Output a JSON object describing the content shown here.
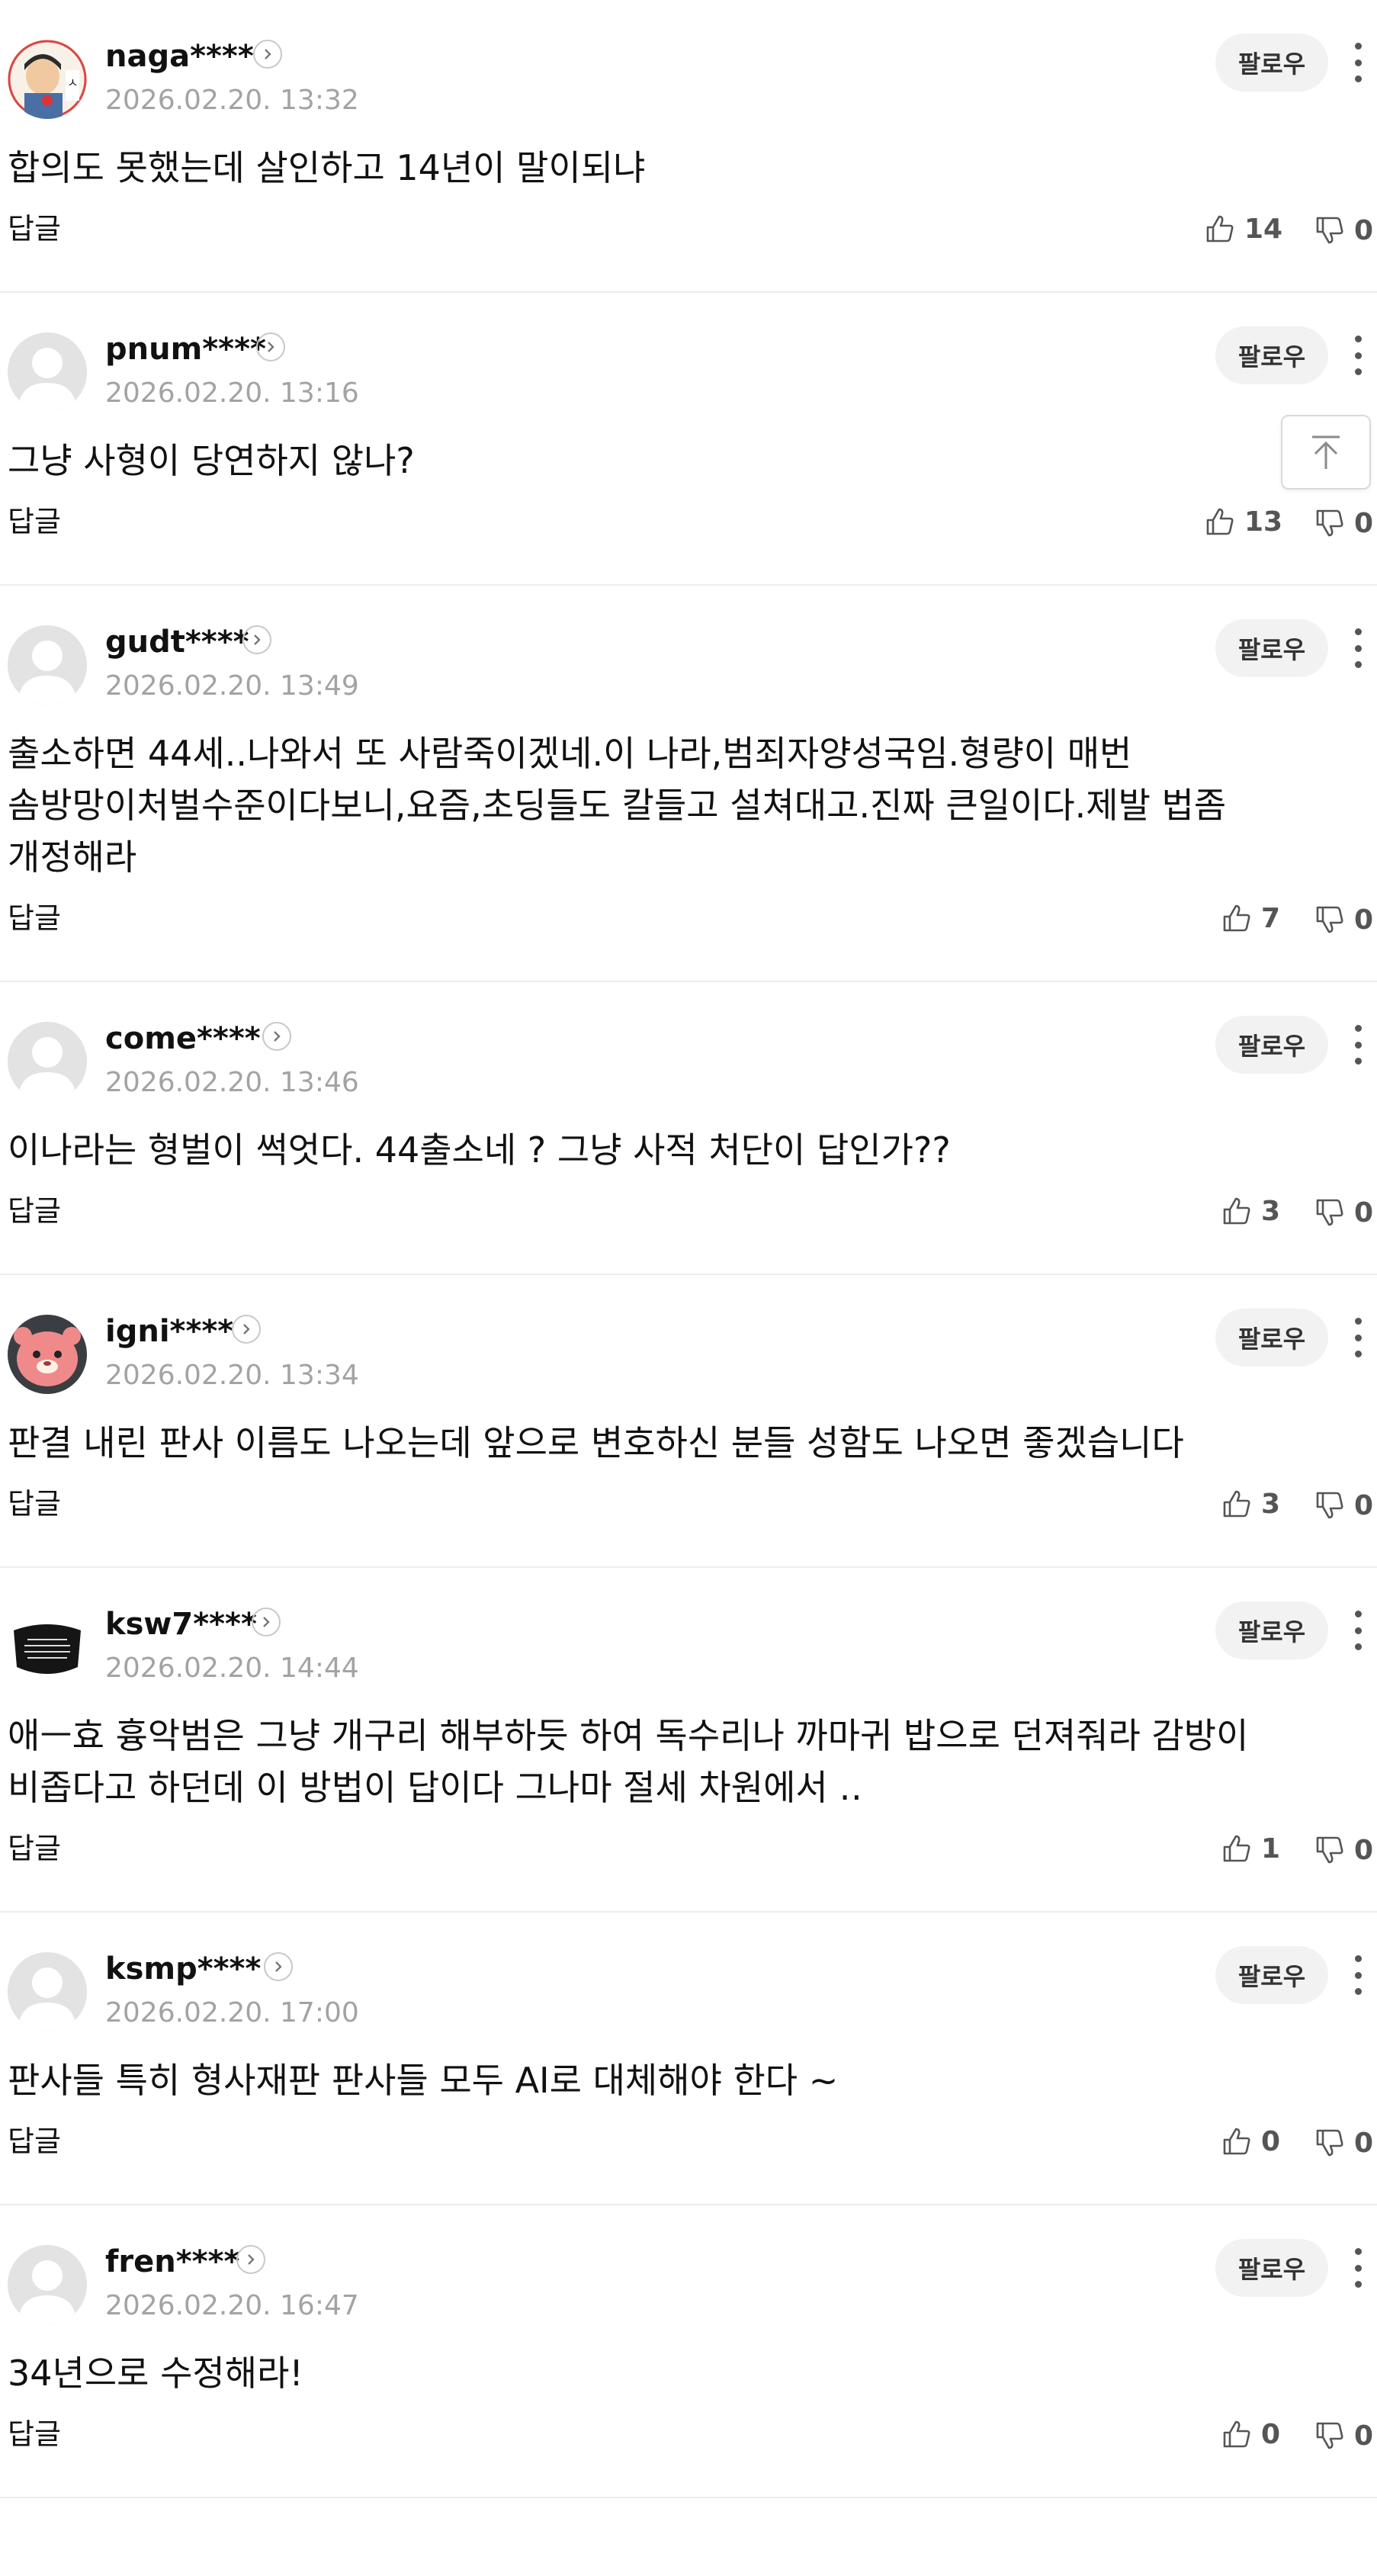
{
  "ui": {
    "follow_label": "팔로우",
    "reply_label": "답글"
  },
  "comments": [
    {
      "username": "naga****",
      "timestamp": "2026.02.20. 13:32",
      "text": "합의도 못했는데 살인하고 14년이 말이되냐",
      "likes": "14",
      "dislikes": "0",
      "avatar": "cartoon-avatar-1"
    },
    {
      "username": "pnum****",
      "timestamp": "2026.02.20. 13:16",
      "text": "그냥 사형이 당연하지 않나?",
      "likes": "13",
      "dislikes": "0",
      "avatar": "default"
    },
    {
      "username": "gudt****",
      "timestamp": "2026.02.20. 13:49",
      "text": "출소하면 44세..나와서 또 사람죽이겠네.이 나라,범죄자양성국임.형량이 매번 솜방망이처벌수준이다보니,요즘,초딩들도 칼들고 설쳐대고.진짜 큰일이다.제발 법좀 개정해라",
      "likes": "7",
      "dislikes": "0",
      "avatar": "default"
    },
    {
      "username": "come****",
      "timestamp": "2026.02.20. 13:46",
      "text": "이나라는 형벌이 썩엇다. 44출소네 ? 그냥 사적 처단이 답인가??",
      "likes": "3",
      "dislikes": "0",
      "avatar": "default"
    },
    {
      "username": "igni****",
      "timestamp": "2026.02.20. 13:34",
      "text": "판결 내린 판사 이름도 나오는데 앞으로 변호하신 분들 성함도 나오면 좋겠습니다",
      "likes": "3",
      "dislikes": "0",
      "avatar": "pink-character"
    },
    {
      "username": "ksw7****",
      "timestamp": "2026.02.20. 14:44",
      "text": "애ㅡ효 흉악범은 그냥 개구리 해부하듯 하여 독수리나 까마귀 밥으로 던져줘라 감방이 비좁다고 하던데 이 방법이 답이다 그나마 절세 차원에서 ‥",
      "likes": "1",
      "dislikes": "0",
      "avatar": "black-mask"
    },
    {
      "username": "ksmp****",
      "timestamp": "2026.02.20. 17:00",
      "text": "판사들 특히 형사재판 판사들 모두 AI로 대체해야 한다 ~",
      "likes": "0",
      "dislikes": "0",
      "avatar": "default"
    },
    {
      "username": "fren****",
      "timestamp": "2026.02.20. 16:47",
      "text": "34년으로 수정해라!",
      "likes": "0",
      "dislikes": "0",
      "avatar": "default"
    }
  ],
  "icons": {
    "like": "thumbs-up-icon",
    "dislike": "thumbs-down-icon",
    "more": "more-vertical-icon",
    "profile": "chevron-right-icon",
    "scroll_top": "arrow-up-to-top-icon"
  }
}
